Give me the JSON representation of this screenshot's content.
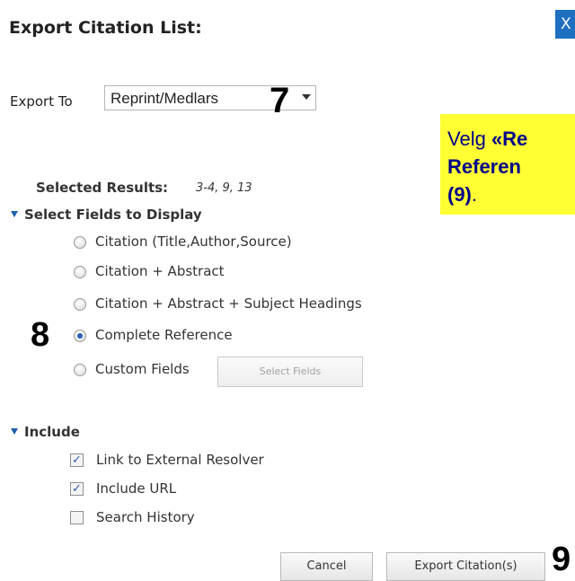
{
  "dialog": {
    "title": "Export Citation List:",
    "close_label": "X"
  },
  "export_to": {
    "label": "Export To",
    "selected": "Reprint/Medlars"
  },
  "steps": {
    "seven": "7",
    "eight": "8",
    "nine": "9"
  },
  "callout": {
    "line1_prefix": "Velg ",
    "line1_bold": "«Re",
    "line2_bold": "Referen",
    "line3_bold": "(9)",
    "line3_suffix": "."
  },
  "selected_results": {
    "label": "Selected Results:",
    "value": "3-4, 9, 13"
  },
  "fields_section": {
    "heading": "Select Fields to Display",
    "options": [
      {
        "label": "Citation (Title,Author,Source)",
        "selected": false
      },
      {
        "label": "Citation + Abstract",
        "selected": false
      },
      {
        "label": "Citation + Abstract + Subject Headings",
        "selected": false
      },
      {
        "label": "Complete Reference",
        "selected": true
      },
      {
        "label": "Custom Fields",
        "selected": false
      }
    ],
    "select_fields_button": "Select Fields"
  },
  "include_section": {
    "heading": "Include",
    "options": [
      {
        "label": "Link to External Resolver",
        "checked": true
      },
      {
        "label": "Include URL",
        "checked": true
      },
      {
        "label": "Search History",
        "checked": false
      }
    ]
  },
  "footer": {
    "cancel_label": "Cancel",
    "export_label": "Export Citation(s)"
  },
  "colors": {
    "close_button": "#1f6fc0",
    "callout_bg": "#ffff33",
    "callout_text": "#00008b",
    "triangle": "#1f5fa8"
  }
}
